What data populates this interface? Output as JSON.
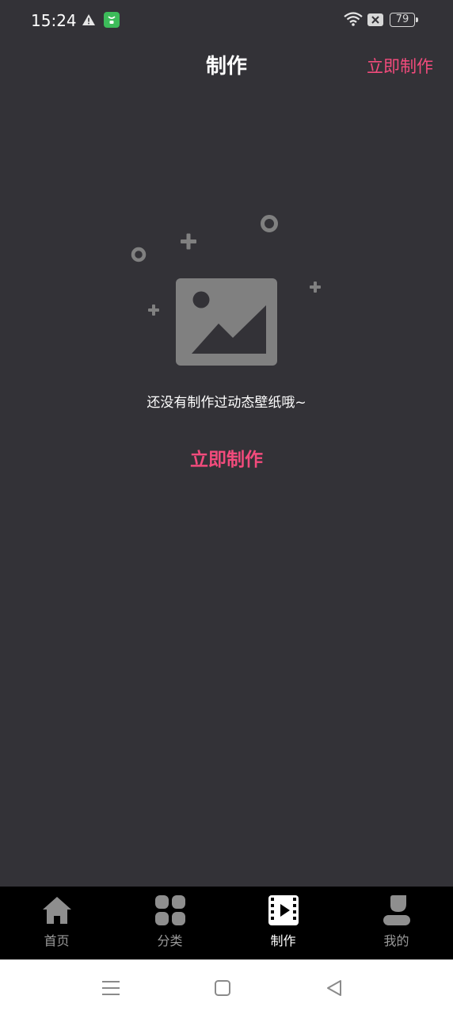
{
  "status_bar": {
    "time": "15:24",
    "battery": "79",
    "icons": [
      "warning-icon",
      "wechat-app-icon",
      "wifi-icon",
      "sim-icon",
      "battery-icon"
    ]
  },
  "header": {
    "title": "制作",
    "action_label": "立即制作"
  },
  "empty_state": {
    "icon": "image-placeholder-icon",
    "message": "还没有制作过动态壁纸哦~",
    "action_label": "立即制作"
  },
  "tab_bar": {
    "active_index": 2,
    "items": [
      {
        "label": "首页",
        "icon": "home-icon"
      },
      {
        "label": "分类",
        "icon": "category-grid-icon"
      },
      {
        "label": "制作",
        "icon": "video-make-icon"
      },
      {
        "label": "我的",
        "icon": "profile-icon"
      }
    ]
  },
  "system_nav": {
    "icons": [
      "menu-icon",
      "home-square-icon",
      "back-icon"
    ]
  },
  "colors": {
    "background": "#333237",
    "accent": "#f24b7c",
    "tab_bar": "#000000",
    "illustration": "#808080"
  }
}
